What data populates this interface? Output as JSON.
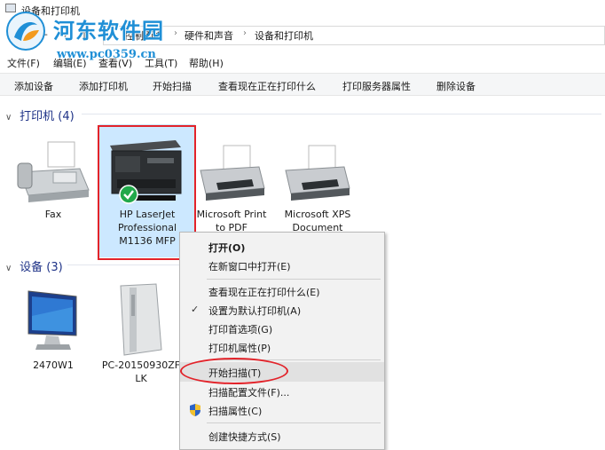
{
  "window": {
    "title": "设备和打印机"
  },
  "watermark": {
    "title": "河东软件园",
    "url": "www.pc0359.cn"
  },
  "address": {
    "back": "←",
    "forward": "→",
    "up": "↑",
    "crumbs": [
      "控制面板",
      "硬件和声音",
      "设备和打印机"
    ],
    "sep": "›"
  },
  "menubar": [
    "文件(F)",
    "编辑(E)",
    "查看(V)",
    "工具(T)",
    "帮助(H)"
  ],
  "toolbar": [
    "添加设备",
    "添加打印机",
    "开始扫描",
    "查看现在正在打印什么",
    "打印服务器属性",
    "删除设备"
  ],
  "printers_group": {
    "label": "打印机 (4)",
    "chevron": "∨",
    "items": [
      {
        "lines": [
          "Fax"
        ],
        "icon": "fax-icon"
      },
      {
        "lines": [
          "HP LaserJet",
          "Professional",
          "M1136 MFP"
        ],
        "icon": "multifunction-printer-icon",
        "selected": true
      },
      {
        "lines": [
          "Microsoft Print",
          "to PDF"
        ],
        "icon": "printer-icon"
      },
      {
        "lines": [
          "Microsoft XPS",
          "Document"
        ],
        "icon": "printer-icon"
      }
    ]
  },
  "devices_group": {
    "label": "设备 (3)",
    "chevron": "∨",
    "items": [
      {
        "lines": [
          "2470W1"
        ],
        "icon": "monitor-icon"
      },
      {
        "lines": [
          "PC-20150930ZF",
          "LK"
        ],
        "icon": "computer-tower-icon"
      }
    ]
  },
  "context_menu": {
    "items": [
      {
        "label": "打开(O)",
        "bold": true
      },
      {
        "label": "在新窗口中打开(E)"
      },
      {
        "label": "查看现在正在打印什么(E)"
      },
      {
        "label": "设置为默认打印机(A)",
        "check": "✓"
      },
      {
        "label": "打印首选项(G)"
      },
      {
        "label": "打印机属性(P)"
      },
      {
        "label": "开始扫描(T)",
        "highlighted": true
      },
      {
        "label": "扫描配置文件(F)..."
      },
      {
        "label": "扫描属性(C)",
        "icon": "uac-shield-icon"
      },
      {
        "label": "创建快捷方式(S)"
      }
    ]
  },
  "colors": {
    "group_header": "#1e3287",
    "selection": "#cce8ff",
    "annotation_red": "#e2232a",
    "watermark_blue": "#1f8fd6",
    "check_green": "#21a84a"
  }
}
